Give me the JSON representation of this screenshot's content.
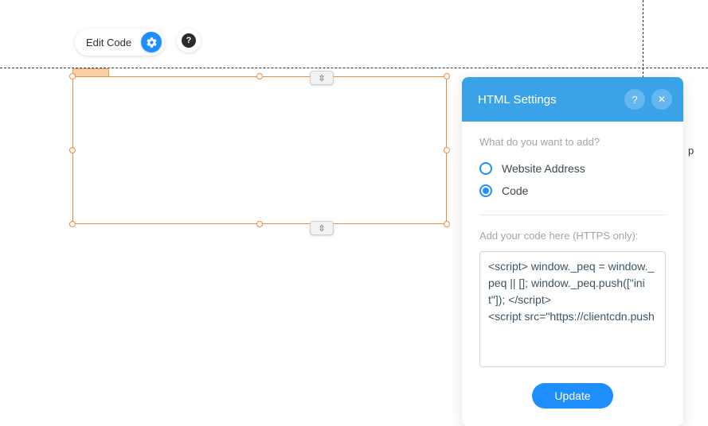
{
  "toolbar": {
    "edit_code_label": "Edit Code"
  },
  "panel": {
    "title": "HTML Settings",
    "question_label": "What do you want to add?",
    "options": {
      "website_address": "Website Address",
      "code": "Code"
    },
    "code_label": "Add your code here (HTTPS only):",
    "code_value": "<script> window._peq = window._peq || []; window._peq.push([\"init\"]); </script>\n<script src=\"https://clientcdn.push",
    "update_label": "Update"
  },
  "side_hint": "p"
}
